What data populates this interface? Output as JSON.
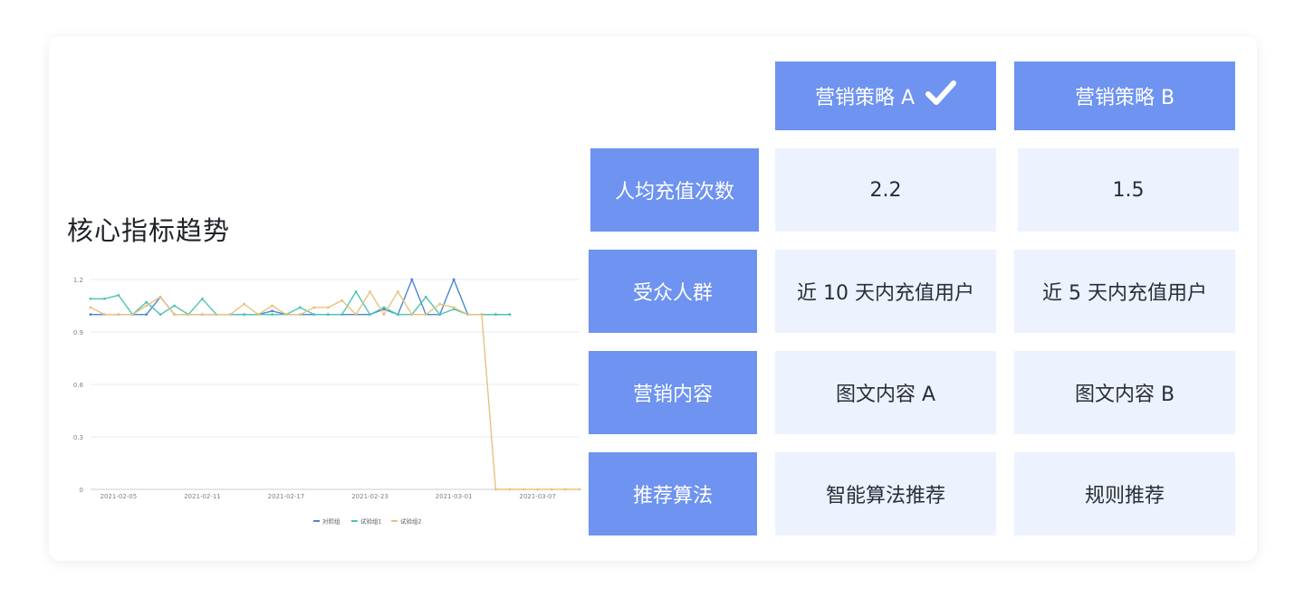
{
  "title": "核心指标趋势",
  "table": {
    "columns": [
      "营销策略 A",
      "营销策略 B"
    ],
    "rows": [
      {
        "label": "人均充值次数",
        "a": "2.2",
        "b": "1.5"
      },
      {
        "label": "受众人群",
        "a": "近 10 天内充值用户",
        "b": "近 5 天内充值用户"
      },
      {
        "label": "营销内容",
        "a": "图文内容 A",
        "b": "图文内容 B"
      },
      {
        "label": "推荐算法",
        "a": "智能算法推荐",
        "b": "规则推荐"
      }
    ]
  },
  "chart_data": {
    "type": "line",
    "x": [
      "2021-02-03",
      "2021-02-04",
      "2021-02-05",
      "2021-02-06",
      "2021-02-07",
      "2021-02-08",
      "2021-02-09",
      "2021-02-10",
      "2021-02-11",
      "2021-02-12",
      "2021-02-13",
      "2021-02-14",
      "2021-02-15",
      "2021-02-16",
      "2021-02-17",
      "2021-02-18",
      "2021-02-19",
      "2021-02-20",
      "2021-02-21",
      "2021-02-22",
      "2021-02-23",
      "2021-02-24",
      "2021-02-25",
      "2021-02-26",
      "2021-02-27",
      "2021-02-28",
      "2021-03-01",
      "2021-03-02",
      "2021-03-03",
      "2021-03-04",
      "2021-03-05",
      "2021-03-06",
      "2021-03-07",
      "2021-03-08",
      "2021-03-09",
      "2021-03-10"
    ],
    "x_tick_labels": [
      "2021-02-05",
      "2021-02-11",
      "2021-02-17",
      "2021-02-23",
      "2021-03-01",
      "2021-03-07"
    ],
    "ylim": [
      0,
      1.2
    ],
    "y_ticks": [
      0,
      0.3,
      0.6,
      0.9,
      1.2
    ],
    "grid": true,
    "legend_position": "bottom-center",
    "series": [
      {
        "name": "对照组",
        "color": "#4a86d4",
        "values": [
          1.0,
          1.0,
          1.0,
          1.0,
          1.0,
          1.1,
          1.0,
          1.0,
          1.0,
          1.0,
          1.0,
          1.0,
          1.0,
          1.02,
          1.0,
          1.0,
          1.0,
          1.0,
          1.0,
          1.0,
          1.0,
          1.03,
          1.0,
          1.2,
          1.0,
          1.0,
          1.2,
          1.0,
          1.0,
          1.0,
          1.0,
          null,
          null,
          null,
          null,
          null
        ]
      },
      {
        "name": "试验组1",
        "color": "#4dc4b4",
        "values": [
          1.09,
          1.09,
          1.11,
          1.0,
          1.07,
          1.0,
          1.05,
          1.0,
          1.09,
          1.0,
          1.0,
          1.0,
          1.0,
          1.0,
          1.0,
          1.04,
          1.0,
          1.0,
          1.0,
          1.13,
          1.0,
          1.04,
          1.0,
          1.0,
          1.1,
          1.0,
          1.03,
          1.0,
          1.0,
          1.0,
          1.0,
          null,
          null,
          null,
          null,
          null
        ]
      },
      {
        "name": "试验组2",
        "color": "#e7c27d",
        "values": [
          1.04,
          1.0,
          1.0,
          1.0,
          1.05,
          1.1,
          1.0,
          1.0,
          1.0,
          1.0,
          1.0,
          1.06,
          1.0,
          1.05,
          1.0,
          1.0,
          1.04,
          1.04,
          1.08,
          1.0,
          1.13,
          1.0,
          1.13,
          1.0,
          1.0,
          1.06,
          1.04,
          1.0,
          1.0,
          0,
          0,
          0,
          0,
          0,
          0,
          0
        ]
      }
    ]
  }
}
